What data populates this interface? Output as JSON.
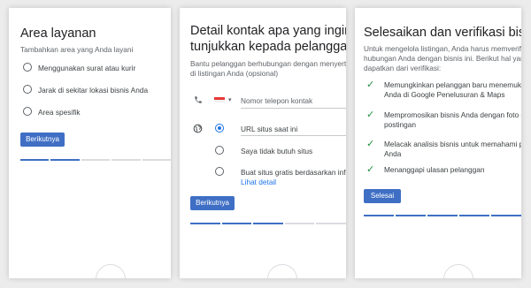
{
  "panel1": {
    "title": "Area layanan",
    "subtitle": "Tambahkan area yang Anda layani",
    "options": [
      "Menggunakan surat atau kurir",
      "Jarak di sekitar lokasi bisnis Anda",
      "Area spesifik"
    ],
    "next_label": "Berikutnya",
    "progress": {
      "segments": 5,
      "completed": 2
    }
  },
  "panel2": {
    "title_line1": "Detail kontak apa yang ingin Anda",
    "title_line2": "tunjukkan kepada pelanggan?",
    "desc_line1": "Bantu pelanggan berhubungan dengan menyertakan",
    "desc_line2": "di listingan Anda (opsional)",
    "phone_placeholder": "Nomor telepon kontak",
    "website_options": [
      "URL situs saat ini",
      "Saya tidak butuh situs",
      "Buat situs gratis berdasarkan info A"
    ],
    "learn_more": "Lihat detail",
    "next_label": "Berikutnya",
    "progress": {
      "segments": 5,
      "completed": 3
    }
  },
  "panel3": {
    "title": "Selesaikan dan verifikasi bisnis ini",
    "desc_line1": "Untuk mengelola listingan, Anda harus memverifikasi",
    "desc_line2": "hubungan Anda dengan bisnis ini. Berikut hal yang A",
    "desc_line3": "dapatkan dari verifikasi:",
    "benefits": [
      [
        "Memungkinkan pelanggan baru menemukan b",
        "Anda di Google Penelusuran & Maps"
      ],
      [
        "Mempromosikan bisnis Anda dengan foto dan",
        "postingan"
      ],
      [
        "Melacak analisis bisnis untuk memahami pela",
        "Anda"
      ],
      [
        "Menanggapi ulasan pelanggan"
      ]
    ],
    "finish_label": "Selesai",
    "progress": {
      "segments": 5,
      "completed": 5
    }
  },
  "colors": {
    "accent": "#3f6fc4",
    "progress_done": "#3f6fc4",
    "progress_todo": "#dadce0",
    "check": "#1e8e3e",
    "flag_red": "#e53935"
  },
  "icons": {
    "phone": "phone-icon",
    "website": "globe-icon",
    "check": "check-icon",
    "dropdown": "chevron-down-icon"
  }
}
